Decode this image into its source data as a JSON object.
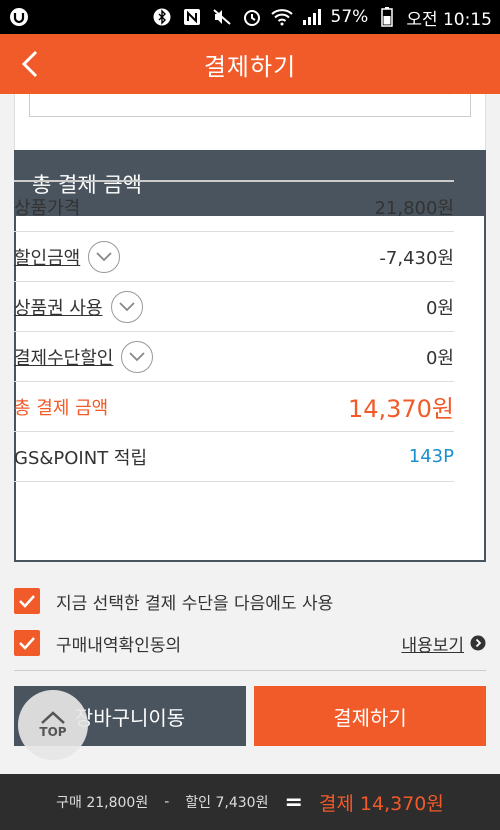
{
  "status_bar": {
    "battery": "57%",
    "time": "오전 10:15"
  },
  "header": {
    "title": "결제하기"
  },
  "summary": {
    "title": "총 결제 금액",
    "rows": [
      {
        "label": "상품가격",
        "value": "21,800원"
      },
      {
        "label": "할인금액",
        "value": "-7,430원"
      },
      {
        "label": "상품권 사용",
        "value": "0원"
      },
      {
        "label": "결제수단할인",
        "value": "0원"
      },
      {
        "label": "총 결제 금액",
        "value": "14,370원"
      },
      {
        "label": "GS&POINT 적립",
        "value": "143P"
      }
    ]
  },
  "checks": {
    "save_method": "지금 선택한 결제 수단을 다음에도 사용",
    "agree": "구매내역확인동의",
    "detail_link": "내용보기"
  },
  "buttons": {
    "cart": "장바구니이동",
    "pay": "결제하기",
    "top": "TOP"
  },
  "bottom_bar": {
    "purchase": "구매 21,800원",
    "minus": "-",
    "discount": "할인 7,430원",
    "equals": "=",
    "payment": "결제 14,370원"
  },
  "colors": {
    "accent": "#f15a29",
    "dark": "#4a545e",
    "point": "#1a8fd1"
  }
}
